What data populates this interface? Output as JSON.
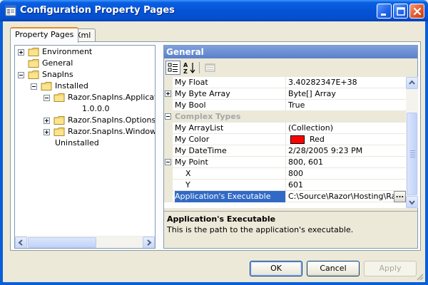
{
  "window": {
    "title": "Configuration Property Pages",
    "caption_buttons": [
      "minimize",
      "maximize",
      "close"
    ]
  },
  "tabs": [
    {
      "label": "Property Pages",
      "active": true
    },
    {
      "label": "Xml",
      "active": false
    }
  ],
  "tree": {
    "nodes": [
      {
        "label": "Environment",
        "expander": "plus",
        "icon": "folder-icon"
      },
      {
        "label": "General",
        "expander": "none",
        "icon": "folder-icon"
      },
      {
        "label": "SnapIns",
        "expander": "minus",
        "icon": "folder-icon"
      },
      {
        "label": "Installed",
        "expander": "minus",
        "icon": "folder-icon"
      },
      {
        "label": "Razor.SnapIns.Applicati",
        "expander": "minus",
        "icon": "folder-icon"
      },
      {
        "label": "1.0.0.0",
        "expander": "none",
        "icon": "none"
      },
      {
        "label": "Razor.SnapIns.OptionsS",
        "expander": "plus",
        "icon": "folder-icon"
      },
      {
        "label": "Razor.SnapIns.Window",
        "expander": "plus",
        "icon": "folder-icon"
      },
      {
        "label": "Uninstalled",
        "expander": "none",
        "icon": "none"
      }
    ]
  },
  "property_grid": {
    "header": "General",
    "toolbar": [
      "categorized-icon",
      "alphabetical-icon",
      "property-pages-icon"
    ],
    "rows": [
      {
        "name": "My Float",
        "value": "3.40282347E+38",
        "kind": "prop"
      },
      {
        "name": "My Byte Array",
        "value": "Byte[] Array",
        "kind": "prop",
        "expander": "plus"
      },
      {
        "name": "My Bool",
        "value": "True",
        "kind": "prop"
      },
      {
        "name": "Complex Types",
        "value": "",
        "kind": "category",
        "expander": "minus"
      },
      {
        "name": "My ArrayList",
        "value": "(Collection)",
        "kind": "prop"
      },
      {
        "name": "My Color",
        "value": "Red",
        "kind": "color",
        "swatch": "#ff0000"
      },
      {
        "name": "My DateTime",
        "value": "2/28/2005 9:23 PM",
        "kind": "prop"
      },
      {
        "name": "My Point",
        "value": "800, 601",
        "kind": "prop",
        "expander": "minus"
      },
      {
        "name": "X",
        "value": "800",
        "kind": "sub"
      },
      {
        "name": "Y",
        "value": "601",
        "kind": "sub"
      },
      {
        "name": "Application's Executable",
        "value": "C:\\Source\\Razor\\Hosting\\Raz",
        "kind": "selected",
        "button": "..."
      }
    ],
    "help": {
      "title": "Application's Executable",
      "description": "This is the path to the application's executable."
    }
  },
  "buttons": {
    "ok": "OK",
    "cancel": "Cancel",
    "apply": "Apply"
  },
  "colors": {
    "titlebar": "#0553d6",
    "selection": "#316ac5",
    "pg_header": "#6a8fd2",
    "folder": "#f5d569"
  }
}
